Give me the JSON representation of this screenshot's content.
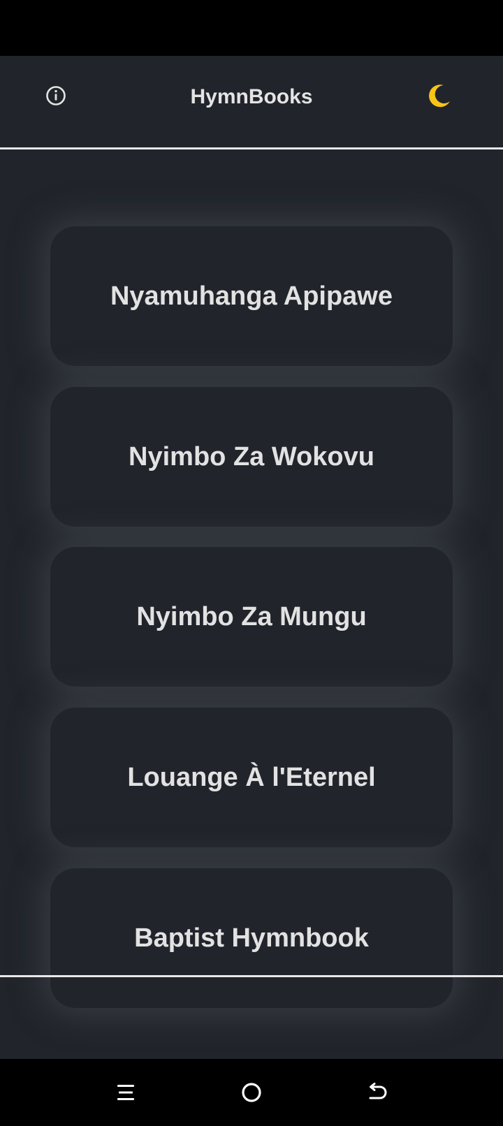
{
  "header": {
    "title": "HymnBooks",
    "info_icon": "info-icon",
    "theme_icon": "crescent-moon-icon",
    "theme_glyph": "🌙"
  },
  "books": [
    {
      "label": "Nyamuhanga Apipawe"
    },
    {
      "label": "Nyimbo Za Wokovu"
    },
    {
      "label": "Nyimbo Za Mungu"
    },
    {
      "label": "Louange À l'Eternel"
    },
    {
      "label": "Baptist Hymnbook"
    }
  ],
  "navigation": {
    "recents_icon": "recents-icon",
    "home_icon": "home-icon",
    "back_icon": "back-icon"
  },
  "colors": {
    "background": "#21252b",
    "card": "#21252b",
    "text": "#e2e2e2",
    "moon": "#f5c518"
  }
}
